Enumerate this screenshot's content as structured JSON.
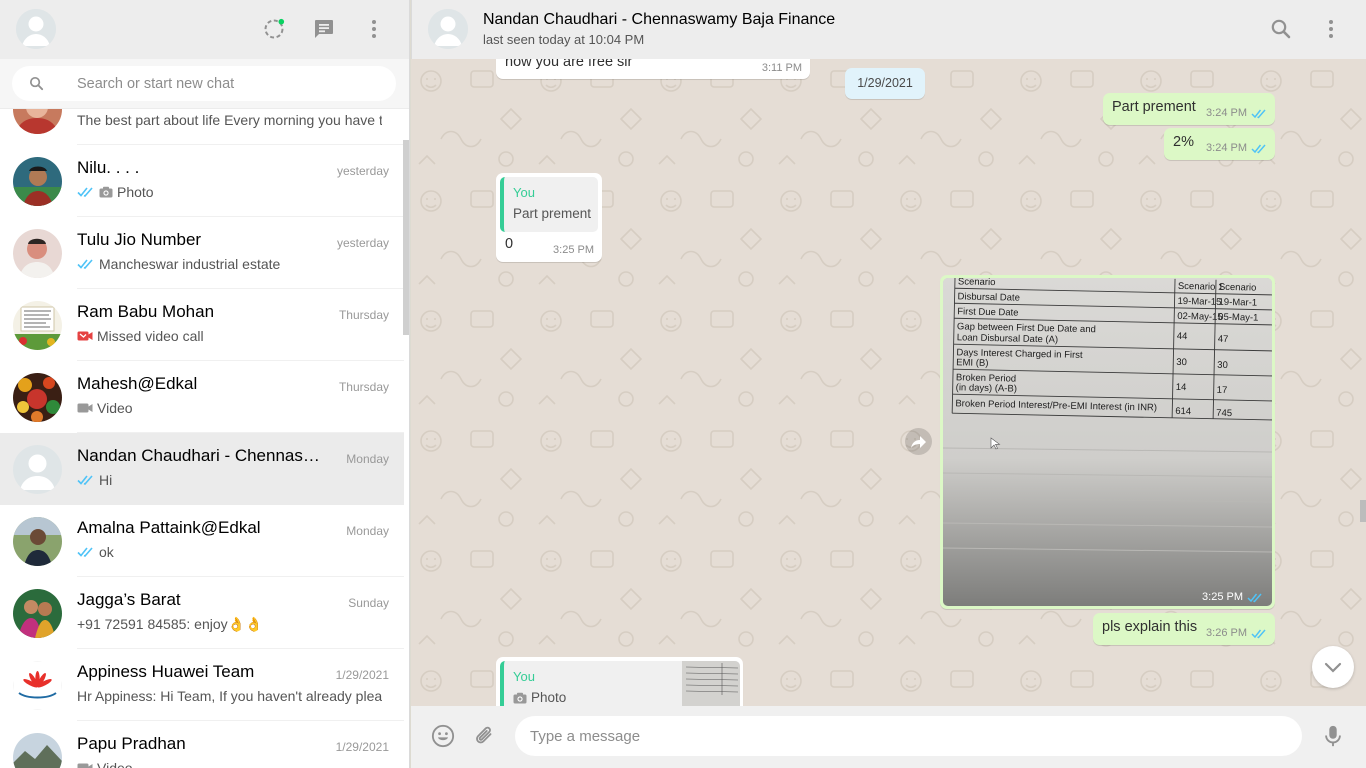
{
  "colors": {
    "header_bg": "#ededed",
    "chat_bg": "#e5ddd5",
    "outgoing_bubble": "#dcf8c6",
    "incoming_bubble": "#ffffff",
    "read_ticks": "#4fc3f7",
    "accent_green": "#35cd96",
    "date_chip": "#e1f3fb",
    "missed_call_red": "#e54242"
  },
  "sidebar": {
    "header": {
      "icons": [
        "default-avatar",
        "status-icon",
        "new-chat-icon",
        "menu-icon"
      ]
    },
    "search": {
      "placeholder": "Search or start new chat"
    },
    "chats": [
      {
        "name": "",
        "time": "",
        "last": "The best part about life  Every morning you have two choices",
        "icon": "none",
        "avatar": "photo"
      },
      {
        "name": "Nilu. . . .",
        "time": "yesterday",
        "last": "Photo",
        "icon": "double-tick+camera",
        "avatar": "photo"
      },
      {
        "name": "Tulu Jio Number",
        "time": "yesterday",
        "last": "Mancheswar industrial estate",
        "icon": "double-tick",
        "avatar": "photo"
      },
      {
        "name": "Ram Babu Mohan",
        "time": "Thursday",
        "last": "Missed video call",
        "icon": "missed-video-call",
        "avatar": "photo"
      },
      {
        "name": "Mahesh@Edkal",
        "time": "Thursday",
        "last": "Video",
        "icon": "video",
        "avatar": "photo"
      },
      {
        "name": "Nandan Chaudhari - Chennaswamy Baja Finance",
        "time": "Monday",
        "last": "Hi",
        "icon": "double-tick",
        "avatar": "default",
        "active": true
      },
      {
        "name": "Amalna Pattaink@Edkal",
        "time": "Monday",
        "last": "ok",
        "icon": "double-tick",
        "avatar": "photo"
      },
      {
        "name": "Jagga’s Barat",
        "time": "Sunday",
        "last": "+91 72591 84585: enjoy👌👌",
        "icon": "none",
        "avatar": "photo"
      },
      {
        "name": "Appiness Huawei Team",
        "time": "1/29/2021",
        "last": "Hr Appiness: Hi Team, If you haven't already please",
        "icon": "none",
        "avatar": "logo"
      },
      {
        "name": "Papu Pradhan",
        "time": "1/29/2021",
        "last": "Video",
        "icon": "video",
        "avatar": "photo"
      }
    ]
  },
  "conversation": {
    "contact_name": "Nandan Chaudhari - Chennaswamy Baja Finance",
    "contact_status": "last seen today at 10:04 PM",
    "header_icons": [
      "search-icon",
      "menu-icon"
    ],
    "messages": {
      "m0_text": "how you are free sir",
      "m0_time": "3:11 PM",
      "date_chip": "1/29/2021",
      "m1_text": "Part prement",
      "m1_time": "3:24 PM",
      "m2_text": "2%",
      "m2_time": "3:24 PM",
      "m3_quote_who": "You",
      "m3_quote_text": "Part prement",
      "m3_text": "0",
      "m3_time": "3:25 PM",
      "m4_time": "3:25 PM",
      "m5_text": "pls explain this",
      "m5_time": "3:26 PM",
      "m6_quote_who": "You",
      "m6_quote_text": "Photo"
    },
    "image_document": {
      "rows": [
        {
          "label": "Scenario",
          "c1": "Scenario 1",
          "c2": "Scenario"
        },
        {
          "label": "Disbursal Date",
          "c1": "19-Mar-15",
          "c2": "19-Mar-1"
        },
        {
          "label": "First Due Date",
          "c1": "02-May-15",
          "c2": "05-May-1"
        },
        {
          "label": "Gap between First Due Date and",
          "label2": "Loan Disbursal Date (A)",
          "c1": "44",
          "c2": "47"
        },
        {
          "label": "Days Interest Charged in First",
          "label2": "EMI (B)",
          "c1": "30",
          "c2": "30"
        },
        {
          "label": "Broken Period",
          "label2": "(in days) (A-B)",
          "c1": "14",
          "c2": "17"
        },
        {
          "label": "Broken Period Interest/Pre-EMI Interest (in INR)",
          "c1": "614",
          "c2": "745"
        }
      ]
    }
  },
  "composer": {
    "placeholder": "Type a message",
    "icons": [
      "emoji-icon",
      "attach-icon",
      "mic-icon"
    ]
  }
}
